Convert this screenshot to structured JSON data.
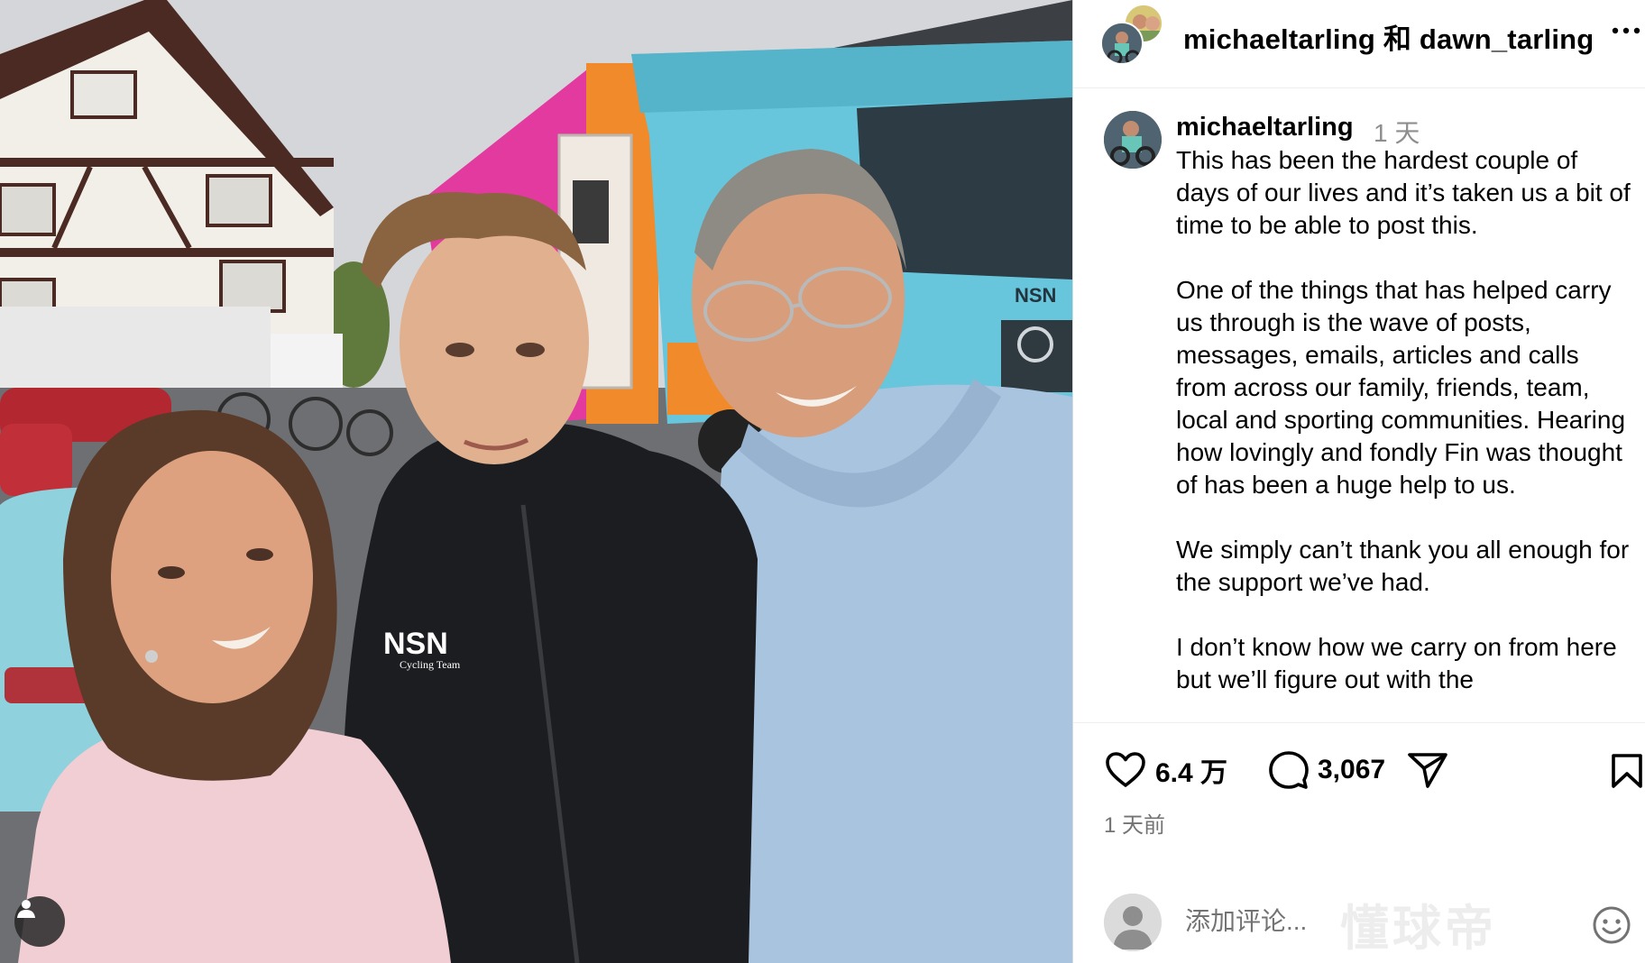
{
  "photo": {
    "jacket_logo": "NSN",
    "jacket_sublogo": "Cycling Team",
    "truck_logo": "NSN"
  },
  "header": {
    "user1": "michaeltarling",
    "joiner": "和",
    "user2": "dawn_tarling",
    "more_icon": "more-horizontal-icon"
  },
  "caption": {
    "username": "michaeltarling",
    "time": "1 天",
    "paragraphs": [
      "This has been the hardest couple of days of our lives and it’s taken us a bit of time to be able to post this.",
      "One of the things that has helped carry us through is the wave of posts, messages, emails, articles and calls from across our family, friends, team, local and sporting communities. Hearing how lovingly and fondly Fin was thought of has been a huge help to us.",
      "We simply can’t thank you all enough for the support we’ve had.",
      "I don’t know how we carry on from here but we’ll figure out with the"
    ]
  },
  "actions": {
    "likes": "6.4 万",
    "comments": "3,067",
    "icons": [
      "heart-icon",
      "comment-icon",
      "share-icon",
      "bookmark-icon"
    ]
  },
  "post_age": "1 天前",
  "comment_box": {
    "placeholder": "添加评论...",
    "value": ""
  },
  "watermark": "懂球帝",
  "colors": {
    "text": "#000000",
    "muted": "#8e8e8e",
    "divider": "#efefef",
    "hoodie": "#a9c4df",
    "truck_cab": "#67c6dc",
    "truck_body_orange": "#f08a2a",
    "truck_body_pink": "#e33aa0"
  }
}
